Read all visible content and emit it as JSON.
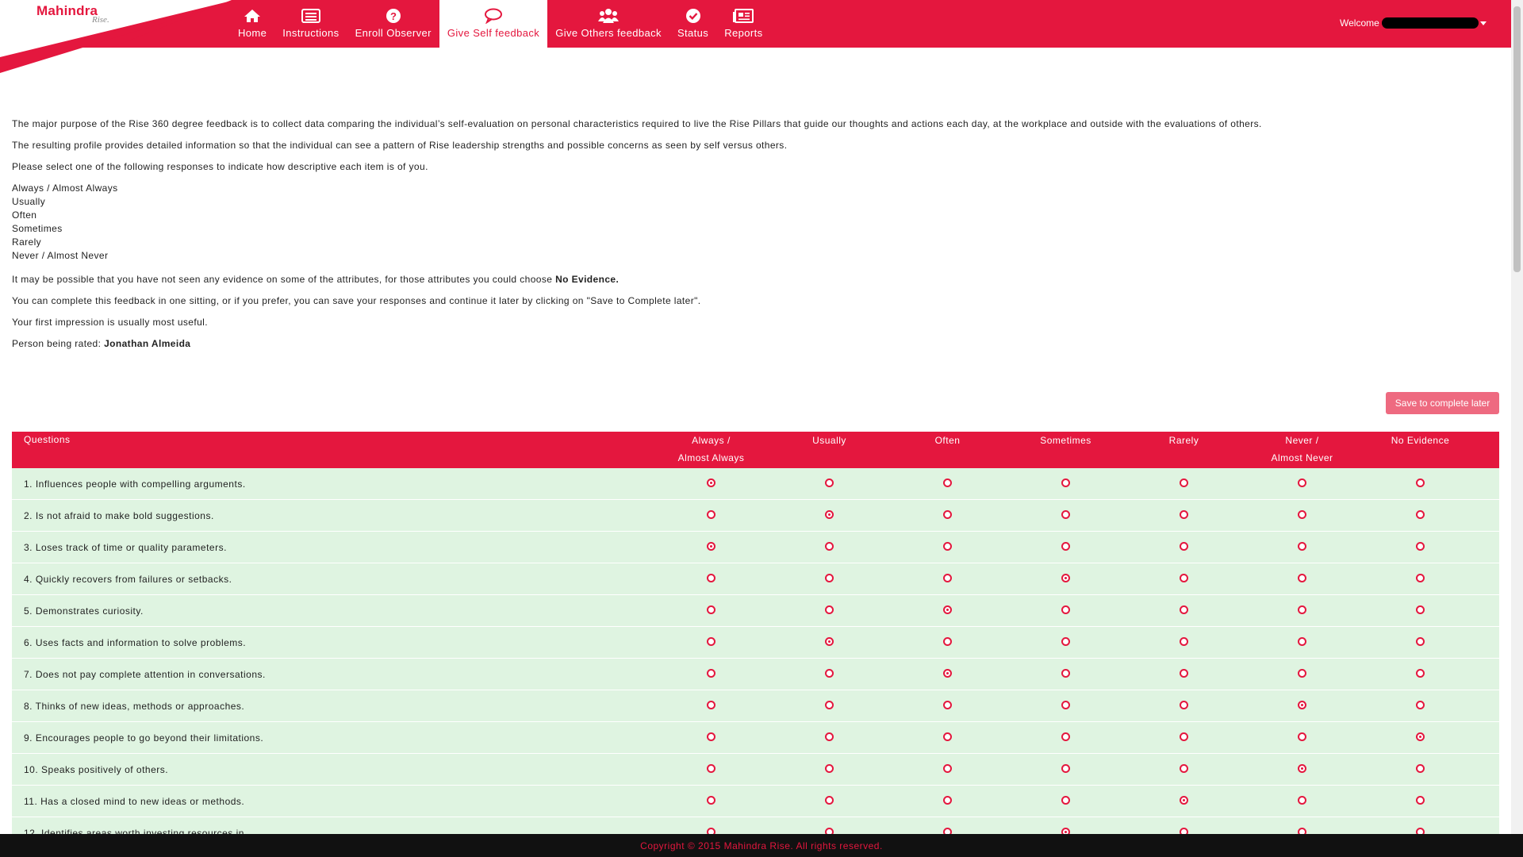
{
  "brand": {
    "name": "Mahindra",
    "tagline": "Rise."
  },
  "colors": {
    "accent": "#e4173e",
    "row_bg": "#dff4e1",
    "button": "#ee6a80",
    "footer_bg": "#111111"
  },
  "nav": {
    "items": [
      {
        "label": "Home",
        "icon": "home-icon"
      },
      {
        "label": "Instructions",
        "icon": "list-icon"
      },
      {
        "label": "Enroll Observer",
        "icon": "question-icon"
      },
      {
        "label": "Give Self feedback",
        "icon": "comment-icon",
        "active": true
      },
      {
        "label": "Give Others feedback",
        "icon": "users-icon"
      },
      {
        "label": "Status",
        "icon": "check-circle-icon"
      },
      {
        "label": "Reports",
        "icon": "newspaper-icon"
      }
    ]
  },
  "user": {
    "welcome_label": "Welcome"
  },
  "intro": {
    "p1": "The major purpose of the Rise 360 degree feedback is to collect data comparing the individual’s self-evaluation on personal characteristics required to live the Rise Pillars that guide our thoughts and actions each day, at the workplace and outside with the evaluations of others.",
    "p2": "The resulting profile provides detailed information so that the individual can see a pattern of Rise leadership strengths and possible concerns as seen by self versus others.",
    "p3": "Please select one of the following responses to indicate how descriptive each item is of you.",
    "responses": [
      "Always / Almost Always",
      "Usually",
      "Often",
      "Sometimes",
      "Rarely",
      "Never / Almost Never"
    ],
    "p4_prefix": "It may be possible that you have not seen any evidence on some of the attributes, for those attributes you could choose ",
    "p4_bold": "No Evidence.",
    "p5": "You can complete this feedback in one sitting, or if you prefer, you can save your responses and continue it later by clicking on \"Save to Complete later\".",
    "p6": "Your first impression is usually most useful.",
    "rated_label": "Person being rated: ",
    "rated_name": "Jonathan Almeida"
  },
  "save_button": "Save to complete later",
  "table": {
    "questions_header": "Questions",
    "options": [
      [
        "Always /",
        "Almost Always"
      ],
      [
        "Usually",
        ""
      ],
      [
        "Often",
        ""
      ],
      [
        "Sometimes",
        ""
      ],
      [
        "Rarely",
        ""
      ],
      [
        "Never /",
        "Almost Never"
      ],
      [
        "No Evidence",
        ""
      ]
    ],
    "rows": [
      {
        "q": "1. Influences people with compelling arguments.",
        "selected": 0
      },
      {
        "q": "2. Is not afraid to make bold suggestions.",
        "selected": 1
      },
      {
        "q": "3. Loses track of time or quality parameters.",
        "selected": 0
      },
      {
        "q": "4. Quickly recovers from failures or setbacks.",
        "selected": 3
      },
      {
        "q": "5. Demonstrates curiosity.",
        "selected": 2
      },
      {
        "q": "6. Uses facts and information to solve problems.",
        "selected": 1
      },
      {
        "q": "7. Does not pay complete attention in conversations.",
        "selected": 2
      },
      {
        "q": "8. Thinks of new ideas, methods or approaches.",
        "selected": 5
      },
      {
        "q": "9. Encourages people to go beyond their limitations.",
        "selected": 6
      },
      {
        "q": "10. Speaks positively of others.",
        "selected": 5
      },
      {
        "q": "11. Has a closed mind to new ideas or methods.",
        "selected": 4
      },
      {
        "q": "12. Identifies areas worth investing resources in.",
        "selected": 3
      }
    ]
  },
  "footer": "Copyright © 2015 Mahindra Rise. All rights reserved."
}
